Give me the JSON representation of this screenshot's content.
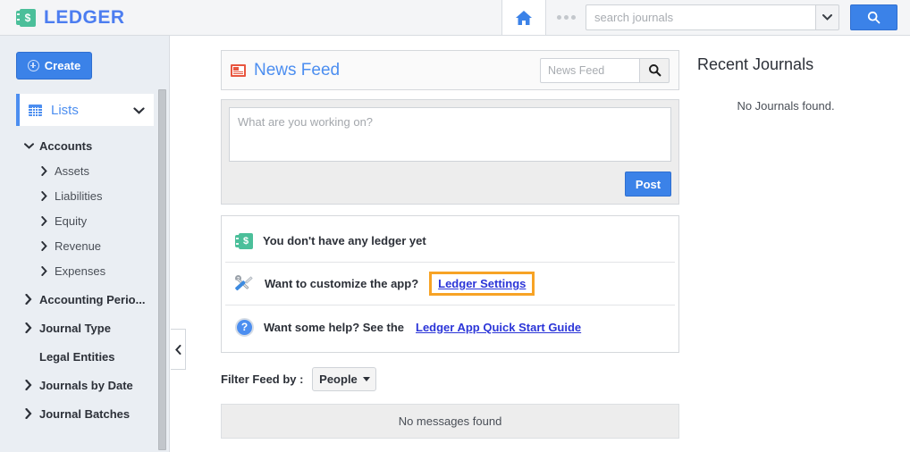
{
  "topbar": {
    "brand": "LEDGER",
    "brand_icon": "money-stack-icon",
    "home_icon": "home-icon",
    "overflow_icon": "three-dots-icon",
    "search_placeholder": "search journals",
    "search_value": "",
    "search_caret_icon": "chevron-down-icon",
    "search_button_icon": "search-icon",
    "accent_color": "#3b82e8"
  },
  "sidebar": {
    "create_label": "Create",
    "create_icon": "plus-circle-icon",
    "lists_label": "Lists",
    "lists_icon": "grid-icon",
    "lists_caret_icon": "chevron-down-icon",
    "collapse_icon": "chevron-left-icon",
    "items": [
      {
        "label": "Accounts",
        "level": 1,
        "chevron": "chevron-down-icon"
      },
      {
        "label": "Assets",
        "level": 2,
        "chevron": "chevron-right-icon"
      },
      {
        "label": "Liabilities",
        "level": 2,
        "chevron": "chevron-right-icon"
      },
      {
        "label": "Equity",
        "level": 2,
        "chevron": "chevron-right-icon"
      },
      {
        "label": "Revenue",
        "level": 2,
        "chevron": "chevron-right-icon"
      },
      {
        "label": "Expenses",
        "level": 2,
        "chevron": "chevron-right-icon"
      },
      {
        "label": "Accounting Perio...",
        "level": 1,
        "chevron": "chevron-right-icon"
      },
      {
        "label": "Journal Type",
        "level": 1,
        "chevron": "chevron-right-icon"
      },
      {
        "label": "Legal Entities",
        "level": 1,
        "chevron": ""
      },
      {
        "label": "Journals by Date",
        "level": 1,
        "chevron": "chevron-right-icon"
      },
      {
        "label": "Journal Batches",
        "level": 1,
        "chevron": "chevron-right-icon"
      }
    ]
  },
  "feed": {
    "title": "News Feed",
    "title_icon": "news-icon",
    "search_placeholder": "News Feed",
    "search_value": "",
    "search_button_icon": "search-icon",
    "composer_placeholder": "What are you working on?",
    "composer_value": "",
    "post_label": "Post",
    "tips": [
      {
        "icon": "money-stack-icon",
        "text": "You don't have any ledger yet",
        "link": "",
        "highlighted": false
      },
      {
        "icon": "tools-icon",
        "text": "Want to customize the app?",
        "link": "Ledger Settings",
        "highlighted": true
      },
      {
        "icon": "help-icon",
        "text": "Want some help? See the",
        "link": "Ledger App Quick Start Guide",
        "highlighted": false
      }
    ],
    "highlight_color": "#f7a325",
    "filter_label": "Filter Feed by :",
    "filter_value": "People",
    "filter_caret_icon": "caret-down-icon",
    "empty_messages": "No messages found"
  },
  "recent": {
    "title": "Recent Journals",
    "empty": "No Journals found."
  }
}
